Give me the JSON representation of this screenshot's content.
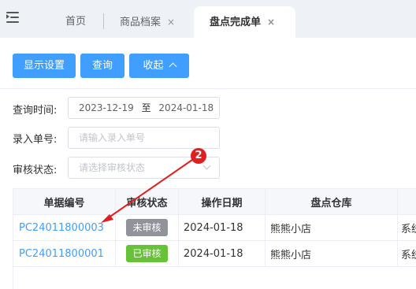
{
  "tabs": [
    {
      "label": "首页"
    },
    {
      "label": "商品档案",
      "close": "×"
    },
    {
      "label": "盘点完成单",
      "close": "×"
    }
  ],
  "toolbar": {
    "display_settings_label": "显示设置",
    "query_label": "查询",
    "collapse_label": "收起"
  },
  "filters": {
    "query_time_label": "查询时间:",
    "date_start": "2023-12-19",
    "date_to": "至",
    "date_end": "2024-01-18",
    "entry_no_label": "录入单号:",
    "entry_no_placeholder": "请输入录入单号",
    "audit_status_label": "审核状态:",
    "audit_status_placeholder": "请选择审核状态"
  },
  "table": {
    "columns": [
      "单据编号",
      "审核状态",
      "操作日期",
      "盘点仓库"
    ],
    "rows": [
      {
        "doc_no": "PC24011800003",
        "status": "未审核",
        "date": "2024-01-18",
        "warehouse": "熊熊小店",
        "extra": "系统"
      },
      {
        "doc_no": "PC24011800001",
        "status": "已审核",
        "date": "2024-01-18",
        "warehouse": "熊熊小店",
        "extra": "系统"
      }
    ]
  },
  "annotation": {
    "marker": "2",
    "color": "#e02020"
  },
  "colors": {
    "primary": "#409eff",
    "unaudited": "#909399",
    "audited": "#67c23a"
  }
}
